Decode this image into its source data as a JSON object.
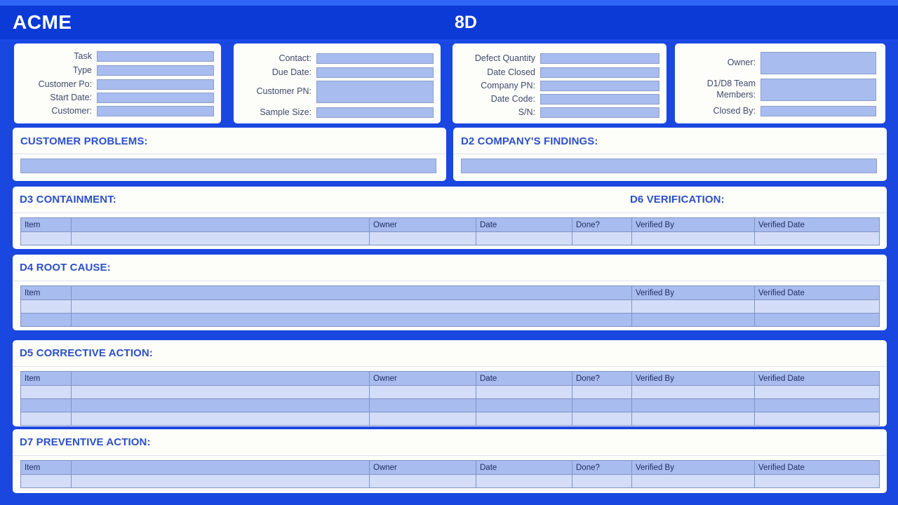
{
  "header": {
    "brand": "ACME",
    "title": "8D"
  },
  "panels": [
    {
      "name": "task-panel",
      "fields": [
        {
          "label": "Task",
          "value": ""
        },
        {
          "label": "Type",
          "value": ""
        },
        {
          "label": "Customer Po:",
          "value": ""
        },
        {
          "label": "Start Date:",
          "value": ""
        },
        {
          "label": "Customer:",
          "value": ""
        }
      ]
    },
    {
      "name": "contact-panel",
      "fields": [
        {
          "label": "Contact:",
          "value": ""
        },
        {
          "label": "Due Date:",
          "value": ""
        },
        {
          "label": "Customer PN:",
          "value": ""
        },
        {
          "label": "Sample Size:",
          "value": ""
        }
      ]
    },
    {
      "name": "defect-panel",
      "fields": [
        {
          "label": "Defect Quantity",
          "value": ""
        },
        {
          "label": "Date Closed",
          "value": ""
        },
        {
          "label": "Company PN:",
          "value": ""
        },
        {
          "label": "Date Code:",
          "value": ""
        },
        {
          "label": "S/N:",
          "value": ""
        }
      ]
    },
    {
      "name": "owner-panel",
      "fields": [
        {
          "label": "Owner:",
          "value": ""
        },
        {
          "label": "D1/D8 Team\nMembers:",
          "value": ""
        },
        {
          "label": "Closed By:",
          "value": ""
        }
      ]
    }
  ],
  "sections": {
    "customer_problems": {
      "title": "CUSTOMER PROBLEMS:",
      "value": ""
    },
    "d2_findings": {
      "title": "D2 COMPANY'S FINDINGS:",
      "value": ""
    },
    "d3_containment": {
      "title": "D3 CONTAINMENT:"
    },
    "d6_verification": {
      "title": "D6 VERIFICATION:"
    },
    "d4_root_cause": {
      "title": "D4 ROOT CAUSE:"
    },
    "d5_corrective_action": {
      "title": "D5 CORRECTIVE ACTION:"
    },
    "d7_preventive_action": {
      "title": "D7 PREVENTIVE ACTION:"
    }
  },
  "tables": {
    "d3": {
      "columns": [
        "Item",
        "",
        "Owner",
        "Date",
        "Done?",
        "Verified By",
        "Verified Date"
      ],
      "rows": [
        [
          "",
          "",
          "",
          "",
          "",
          "",
          ""
        ]
      ]
    },
    "d4": {
      "columns": [
        "Item",
        "",
        "Verified By",
        "Verified Date"
      ],
      "rows": [
        [
          "",
          "",
          "",
          ""
        ],
        [
          "",
          "",
          "",
          ""
        ]
      ]
    },
    "d5": {
      "columns": [
        "Item",
        "",
        "Owner",
        "Date",
        "Done?",
        "Verified By",
        "Verified Date"
      ],
      "rows": [
        [
          "",
          "",
          "",
          "",
          "",
          "",
          ""
        ],
        [
          "",
          "",
          "",
          "",
          "",
          "",
          ""
        ],
        [
          "",
          "",
          "",
          "",
          "",
          "",
          ""
        ]
      ]
    },
    "d7": {
      "columns": [
        "Item",
        "",
        "Owner",
        "Date",
        "Done?",
        "Verified By",
        "Verified Date"
      ],
      "rows": [
        [
          "",
          "",
          "",
          "",
          "",
          "",
          ""
        ]
      ]
    }
  },
  "colors": {
    "background": "#1a47e0",
    "header_band": "#0c3ad6",
    "top_strip": "#2f66f5",
    "card": "#fdfdfa",
    "field_fill": "#a8bcf0",
    "field_border": "#8c9ec9",
    "title_text": "#2b50c8",
    "label_text": "#3f4a6b"
  }
}
